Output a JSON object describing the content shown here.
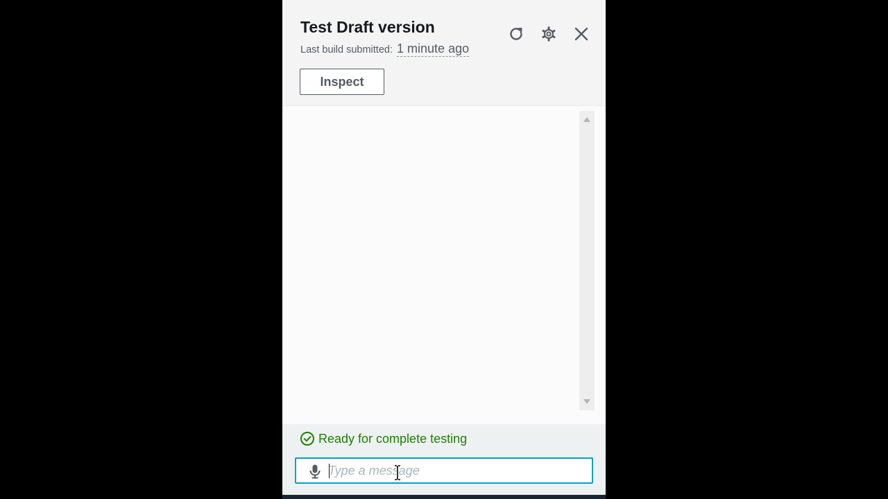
{
  "panel": {
    "title": "Test Draft version",
    "subtitle_label": "Last build submitted:",
    "subtitle_time": "1 minute ago",
    "inspect_label": "Inspect",
    "icons": {
      "refresh": "refresh-icon",
      "settings": "gear-icon",
      "close": "close-icon"
    }
  },
  "footer": {
    "status_text": "Ready for complete testing",
    "status_icon": "check-circle-icon",
    "input_placeholder": "Type a message",
    "input_value": "",
    "mic_icon": "microphone-icon"
  },
  "colors": {
    "status_green": "#1d8102",
    "input_border": "#00a1c9",
    "text_primary": "#16191f",
    "text_secondary": "#545b64"
  }
}
